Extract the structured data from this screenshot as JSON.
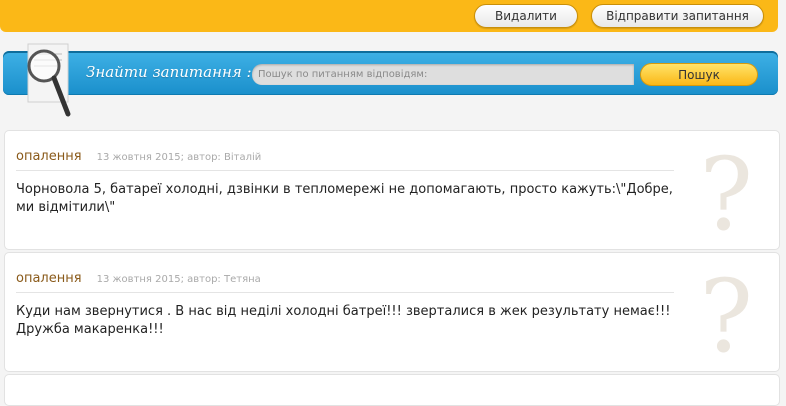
{
  "topbar": {
    "delete_label": "Видалити",
    "ask_label": "Відправити запитання"
  },
  "search": {
    "title": "Знайти запитання :",
    "placeholder": "Пошук по питанням відповідям:",
    "button_label": "Пошук"
  },
  "questions": [
    {
      "category": "опалення",
      "meta": "13 жовтня 2015; автор: Віталій",
      "text": "Чорновола 5, батареї холодні, дзвінки в тепломережі не допомагають, просто кажуть:\\\"Добре, ми відмітили\\\"",
      "mark": "?"
    },
    {
      "category": "опалення",
      "meta": "13 жовтня 2015; автор: Тетяна",
      "text": "Куди нам звернутися . В нас від неділі холодні батреї!!! зверталися в жек результату немає!!! Дружба макаренка!!!",
      "mark": "?"
    }
  ],
  "colors": {
    "topbar": "#fbb817",
    "searchbar": "#1a8fcb",
    "category": "#8a5a1a",
    "question_mark": "#ebe6de"
  },
  "icons": {
    "magnifier": "magnifier-icon"
  }
}
